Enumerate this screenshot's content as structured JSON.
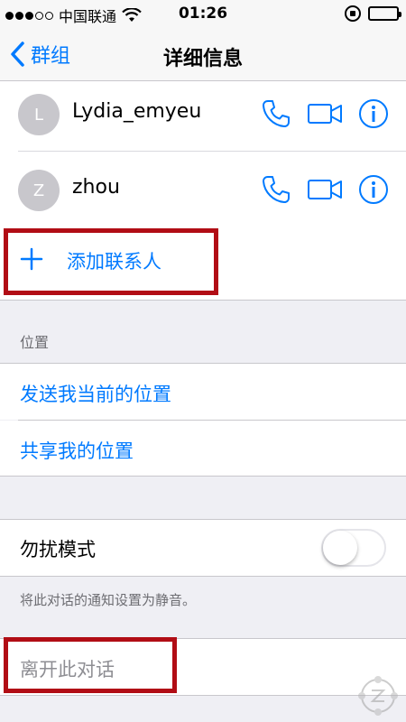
{
  "status_bar": {
    "signal_dots": [
      true,
      true,
      true,
      false,
      false
    ],
    "carrier": "中国联通",
    "time": "01:26",
    "battery_level": 0.95
  },
  "nav": {
    "back_label": "群组",
    "title": "详细信息"
  },
  "contacts": [
    {
      "initial": "L",
      "name": "Lydia_emyeu"
    },
    {
      "initial": "Z",
      "name": "zhou"
    }
  ],
  "add_contact": {
    "label": "添加联系人"
  },
  "location_section": {
    "header": "位置",
    "send_location": "发送我当前的位置",
    "share_location": "共享我的位置"
  },
  "dnd": {
    "label": "勿扰模式",
    "enabled": false,
    "footnote": "将此对话的通知设置为静音。"
  },
  "leave": {
    "label": "离开此对话"
  },
  "colors": {
    "accent": "#007aff",
    "highlight_box": "#b10d15",
    "background": "#efeff4"
  },
  "icons": [
    "wifi-icon",
    "rotation-lock-icon",
    "battery-icon",
    "chevron-left-icon",
    "phone-icon",
    "video-icon",
    "info-icon",
    "plus-icon"
  ]
}
